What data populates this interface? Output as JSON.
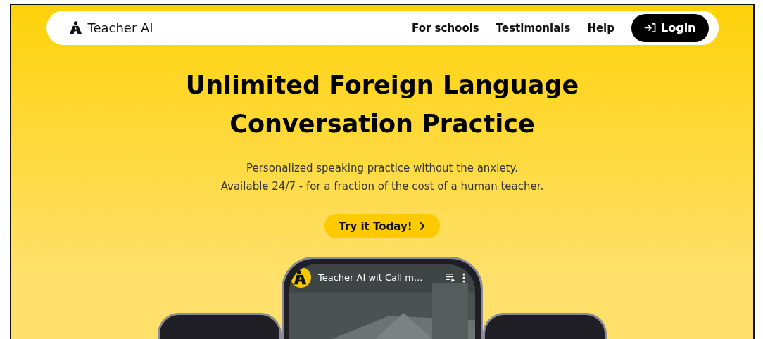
{
  "nav": {
    "brand": "Teacher AI",
    "links": [
      "For schools",
      "Testimonials",
      "Help"
    ],
    "login": "Login"
  },
  "hero": {
    "title_lines": [
      "Unlimited Foreign Language",
      "Conversation Practice"
    ],
    "subtitle_lines": [
      "Personalized speaking practice without the anxiety.",
      "Available 24/7 - for a fraction of the cost of a human teacher."
    ],
    "cta": "Try it Today!"
  },
  "video": {
    "title": "Teacher AI wit Call m...",
    "kind": "picture"
  }
}
